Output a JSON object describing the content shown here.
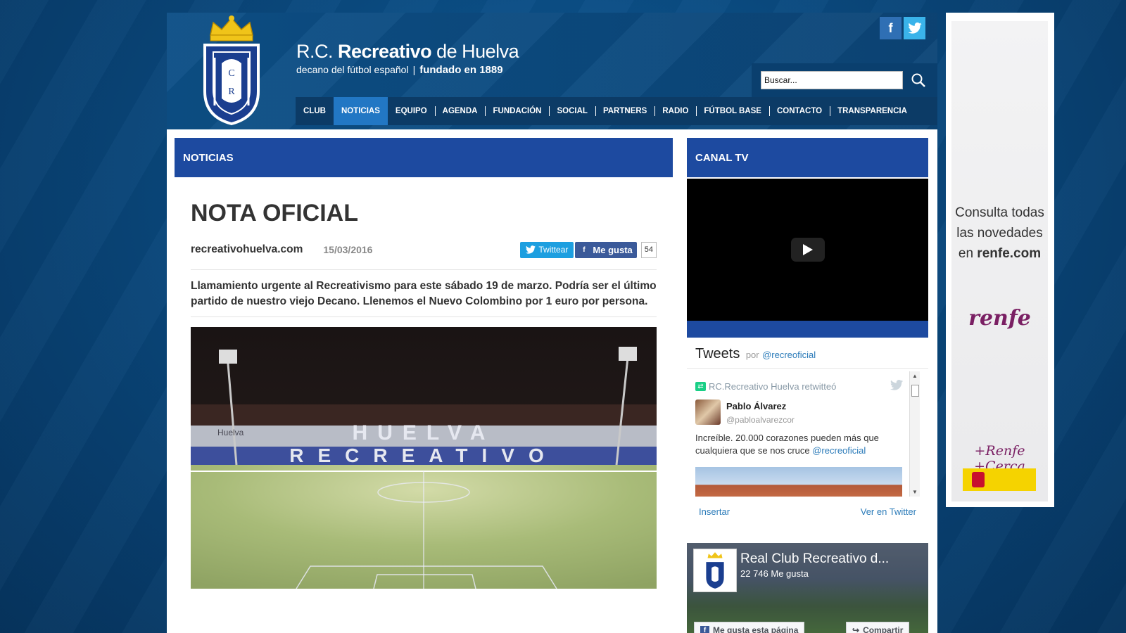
{
  "header": {
    "brand_prefix": "R.C.",
    "brand_main": "Recreativo",
    "brand_suffix": "de Huelva",
    "tagline": "decano del fútbol español",
    "tagline_sep": "|",
    "founded": "fundado en 1889",
    "social": {
      "facebook": "f",
      "twitter": "t"
    },
    "search_placeholder": "Buscar...",
    "search_value": "Buscar..."
  },
  "nav": {
    "items": [
      "CLUB",
      "NOTICIAS",
      "EQUIPO",
      "AGENDA",
      "FUNDACIÓN",
      "SOCIAL",
      "PARTNERS",
      "RADIO",
      "FÚTBOL BASE",
      "CONTACTO",
      "TRANSPARENCIA"
    ],
    "active": "NOTICIAS"
  },
  "main": {
    "section_title": "NOTICIAS",
    "article": {
      "title": "NOTA OFICIAL",
      "source": "recreativohuelva.com",
      "date": "15/03/2016",
      "share": {
        "twitter": "Twittear",
        "facebook": "Me gusta",
        "fb_count": "54"
      },
      "lead": "Llamamiento urgente al Recreativismo para este sábado 19 de marzo. Podría ser el último partido de nuestro viejo Decano. Llenemos el Nuevo Colombino por 1 euro por persona.",
      "image_text_top": "HUELVA",
      "image_text_bottom": "RECREATIVO",
      "image_side_text": "Huelva"
    }
  },
  "sidebar": {
    "canal_title": "CANAL TV",
    "tweets": {
      "title": "Tweets",
      "by": "por",
      "handle": "@recreoficial",
      "retweet_label": "RC.Recreativo Huelva retwitteó",
      "author_name": "Pablo Álvarez",
      "author_handle": "@pabloalvarezcor",
      "text": "Increíble. 20.000 corazones pueden más que cualquiera que se nos cruce",
      "mention": "@recreoficial",
      "embed_link": "Insertar",
      "view_link": "Ver en Twitter"
    },
    "facebook": {
      "page_name": "Real Club Recreativo d...",
      "likes": "22 746 Me gusta",
      "like_button": "Me gusta esta página",
      "share_button": "Compartir"
    }
  },
  "ad": {
    "line1": "Consulta todas",
    "line2": "las novedades",
    "line3_prefix": "en",
    "line3_link": "renfe.com",
    "logo": "renfe",
    "slogan": "+Renfe +Cerca"
  },
  "colors": {
    "header_blue": "#0d4f86",
    "nav_active": "#2277c4",
    "section_bar": "#1d4aa0",
    "renfe_purple": "#7a1f63",
    "crown_gold": "#f0c419"
  }
}
